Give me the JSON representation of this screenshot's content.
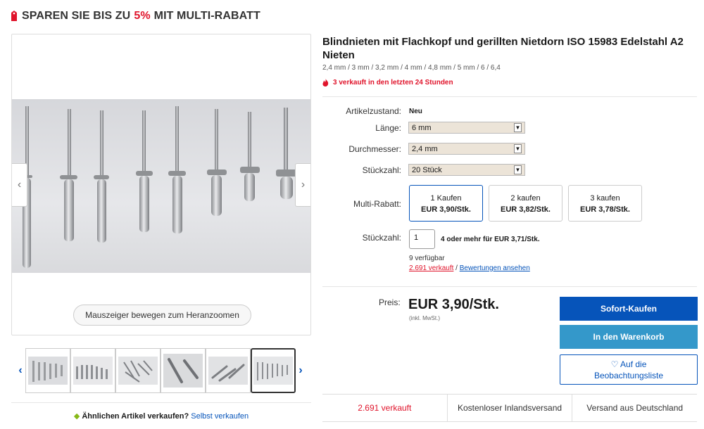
{
  "promo": {
    "prefix": "SPAREN SIE BIS ZU",
    "percent": "5%",
    "suffix": "MIT MULTI-RABATT"
  },
  "gallery": {
    "zoom_hint": "Mauszeiger bewegen zum Heranzoomen",
    "thumbnail_count": 6,
    "selected_thumbnail": 6
  },
  "sell": {
    "question": "Ähnlichen Artikel verkaufen?",
    "link": "Selbst verkaufen"
  },
  "listing": {
    "title": "Blindnieten mit Flachkopf und gerillten Nietdorn ISO 15983 Edelstahl A2 Nieten",
    "subtitle": "2,4 mm / 3 mm / 3,2 mm / 4 mm / 4,8 mm / 5 mm / 6 / 6,4",
    "hot": "3 verkauft in den letzten 24 Stunden"
  },
  "details": {
    "condition_label": "Artikelzustand:",
    "condition_value": "Neu",
    "length_label": "Länge:",
    "length_value": "6 mm",
    "diameter_label": "Durchmesser:",
    "diameter_value": "2,4 mm",
    "pieces_label": "Stückzahl:",
    "pieces_value": "20 Stück",
    "multi_label": "Multi-Rabatt:",
    "multi_options": [
      {
        "qty": "1 Kaufen",
        "price": "EUR 3,90/Stk."
      },
      {
        "qty": "2 kaufen",
        "price": "EUR 3,82/Stk."
      },
      {
        "qty": "3 kaufen",
        "price": "EUR 3,78/Stk."
      }
    ],
    "qty_label": "Stückzahl:",
    "qty_value": "1",
    "qty_note": "4 oder mehr für EUR 3,71/Stk.",
    "available": "9 verfügbar",
    "sold_link": "2.691 verkauft",
    "slash": " / ",
    "reviews_link": "Bewertungen ansehen"
  },
  "pricing": {
    "label": "Preis:",
    "price": "EUR 3,90/Stk.",
    "vat": "(inkl. MwSt.)",
    "buy_now": "Sofort-Kaufen",
    "add_to_cart": "In den Warenkorb",
    "watch_line1": "♡ Auf die",
    "watch_line2": "Beobachtungsliste"
  },
  "stats": [
    "2.691 verkauft",
    "Kostenloser Inlandsversand",
    "Versand aus Deutschland"
  ],
  "colors": {
    "accent_blue": "#0654ba",
    "cart_blue": "#3498ca",
    "alert_red": "#e0142b"
  }
}
